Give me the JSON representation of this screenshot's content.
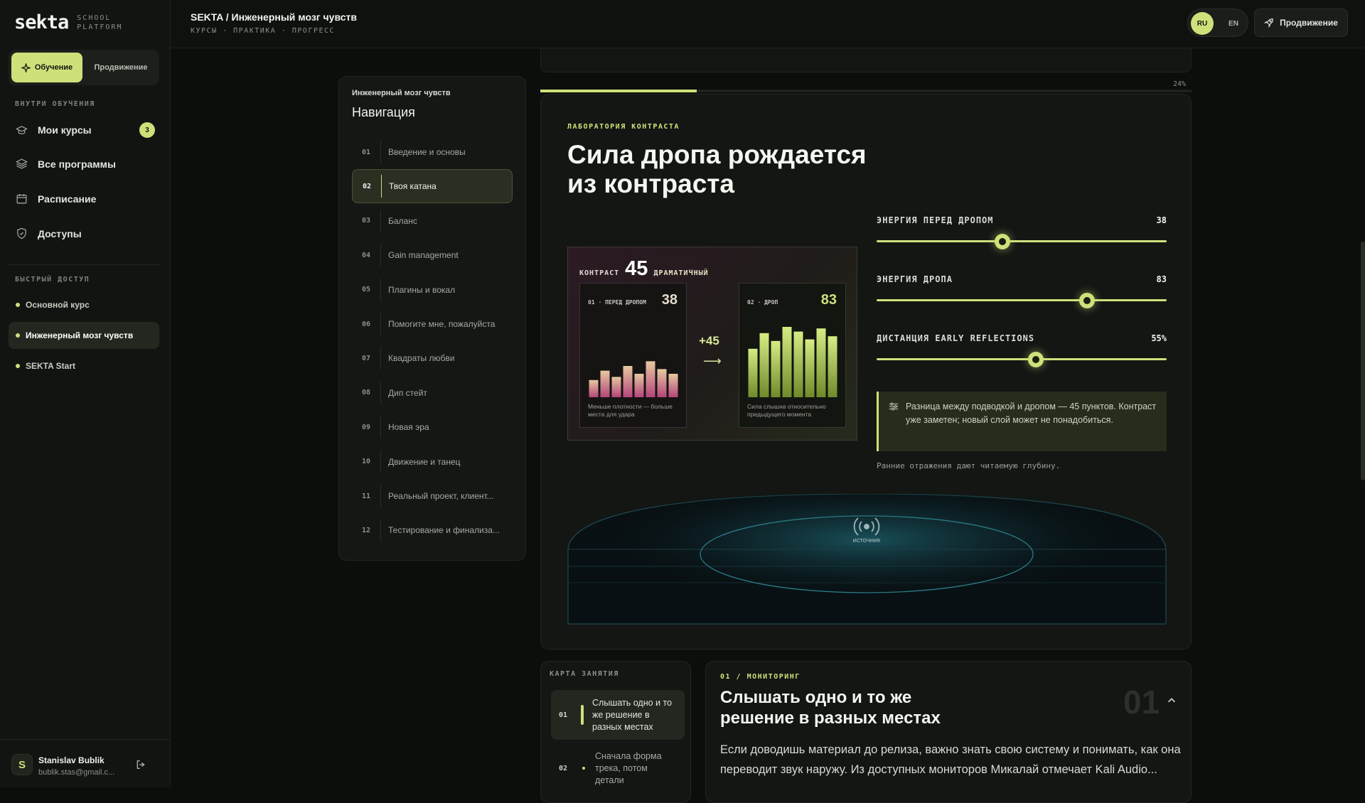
{
  "sidebar": {
    "logo": "sekta",
    "logo_sub1": "SCHOOL",
    "logo_sub2": "PLATFORM",
    "modes": [
      {
        "label": "Обучение",
        "active": true
      },
      {
        "label": "Продвижение",
        "active": false
      }
    ],
    "section_inside": "ВНУТРИ ОБУЧЕНИЯ",
    "items": [
      {
        "label": "Мои курсы",
        "icon": "graduation-cap-icon",
        "badge": "3"
      },
      {
        "label": "Все программы",
        "icon": "layers-icon"
      },
      {
        "label": "Расписание",
        "icon": "calendar-icon"
      },
      {
        "label": "Доступы",
        "icon": "shield-icon"
      }
    ],
    "section_quick": "БЫСТРЫЙ ДОСТУП",
    "quick": [
      {
        "label": "Основной курс",
        "active": false
      },
      {
        "label": "Инженерный мозг чувств",
        "active": true
      },
      {
        "label": "SEKTA Start",
        "active": false
      }
    ],
    "user": {
      "initial": "S",
      "name": "Stanislav Bublik",
      "email": "bublik.stas@gmail.c..."
    }
  },
  "topbar": {
    "title": "SEKTA / Инженерный мозг чувств",
    "subtitle": "КУРСЫ · ПРАКТИКА · ПРОГРЕСС",
    "lang": {
      "ru": "RU",
      "en": "EN",
      "active": "RU"
    },
    "promo_label": "Продвижение"
  },
  "course_nav": {
    "kicker": "Инженерный мозг чувств",
    "title": "Навигация",
    "lessons": [
      {
        "num": "01",
        "title": "Введение и основы"
      },
      {
        "num": "02",
        "title": "Твоя катана",
        "active": true
      },
      {
        "num": "03",
        "title": "Баланс"
      },
      {
        "num": "04",
        "title": "Gain management"
      },
      {
        "num": "05",
        "title": "Плагины и вокал"
      },
      {
        "num": "06",
        "title": "Помогите мне, пожалуйста"
      },
      {
        "num": "07",
        "title": "Квадраты любви"
      },
      {
        "num": "08",
        "title": "Дип стейт"
      },
      {
        "num": "09",
        "title": "Новая эра"
      },
      {
        "num": "10",
        "title": "Движение и танец"
      },
      {
        "num": "11",
        "title": "Реальный проект, клиент..."
      },
      {
        "num": "12",
        "title": "Тестирование и финализа..."
      }
    ]
  },
  "progress": {
    "value": 24,
    "label": "24%"
  },
  "lab": {
    "kicker": "ЛАБОРАТОРИЯ КОНТРАСТА",
    "title": "Сила дропа рождается из контраста",
    "contrast": {
      "label": "КОНТРАСТ",
      "value": "45",
      "mood": "ДРАМАТИЧНЫЙ",
      "before": {
        "label": "01 · ПЕРЕД ДРОПОМ",
        "value": "38",
        "caption": "Меньше плотности — больше места для удара",
        "bars": [
          0.22,
          0.34,
          0.26,
          0.4,
          0.3,
          0.46,
          0.36,
          0.3
        ]
      },
      "drop": {
        "label": "02 · ДРОП",
        "value": "83",
        "caption": "Сила слышна относительно предыдущего момента",
        "bars": [
          0.62,
          0.82,
          0.72,
          0.9,
          0.84,
          0.74,
          0.88,
          0.78
        ]
      },
      "delta": "+45",
      "arrow": "⟶"
    },
    "sliders": [
      {
        "label": "ЭНЕРГИЯ ПЕРЕД ДРОПОМ",
        "value": "38",
        "pos": 0.435
      },
      {
        "label": "ЭНЕРГИЯ ДРОПА",
        "value": "83",
        "pos": 0.725
      },
      {
        "label": "ДИСТАНЦИЯ EARLY REFLECTIONS",
        "value": "55%",
        "pos": 0.55
      }
    ],
    "note": "Разница между подводкой и дропом — 45 пунктов. Контраст уже заметен; новый слой может не понадобиться.",
    "hint": "Ранние отражения дают читаемую глубину.",
    "source_label": "ИСТОЧНИК"
  },
  "lesson_map": {
    "kicker": "КАРТА ЗАНЯТИЯ",
    "items": [
      {
        "num": "01",
        "text": "Слышать одно и то же решение в разных местах",
        "active": true
      },
      {
        "num": "02",
        "text": "Сначала форма трека, потом детали",
        "active": false
      }
    ]
  },
  "monitoring": {
    "kicker": "01 / МОНИТОРИНГ",
    "title": "Слышать одно и то же решение в разных местах",
    "big_num": "01",
    "body": "Если доводишь материал до релиза, важно знать свою систему и понимать, как она переводит звук наружу. Из доступных мониторов Микалай отмечает Kali Audio..."
  },
  "colors": {
    "accent": "#cde17a",
    "bg": "#0c0e0c",
    "panel": "#131613"
  }
}
